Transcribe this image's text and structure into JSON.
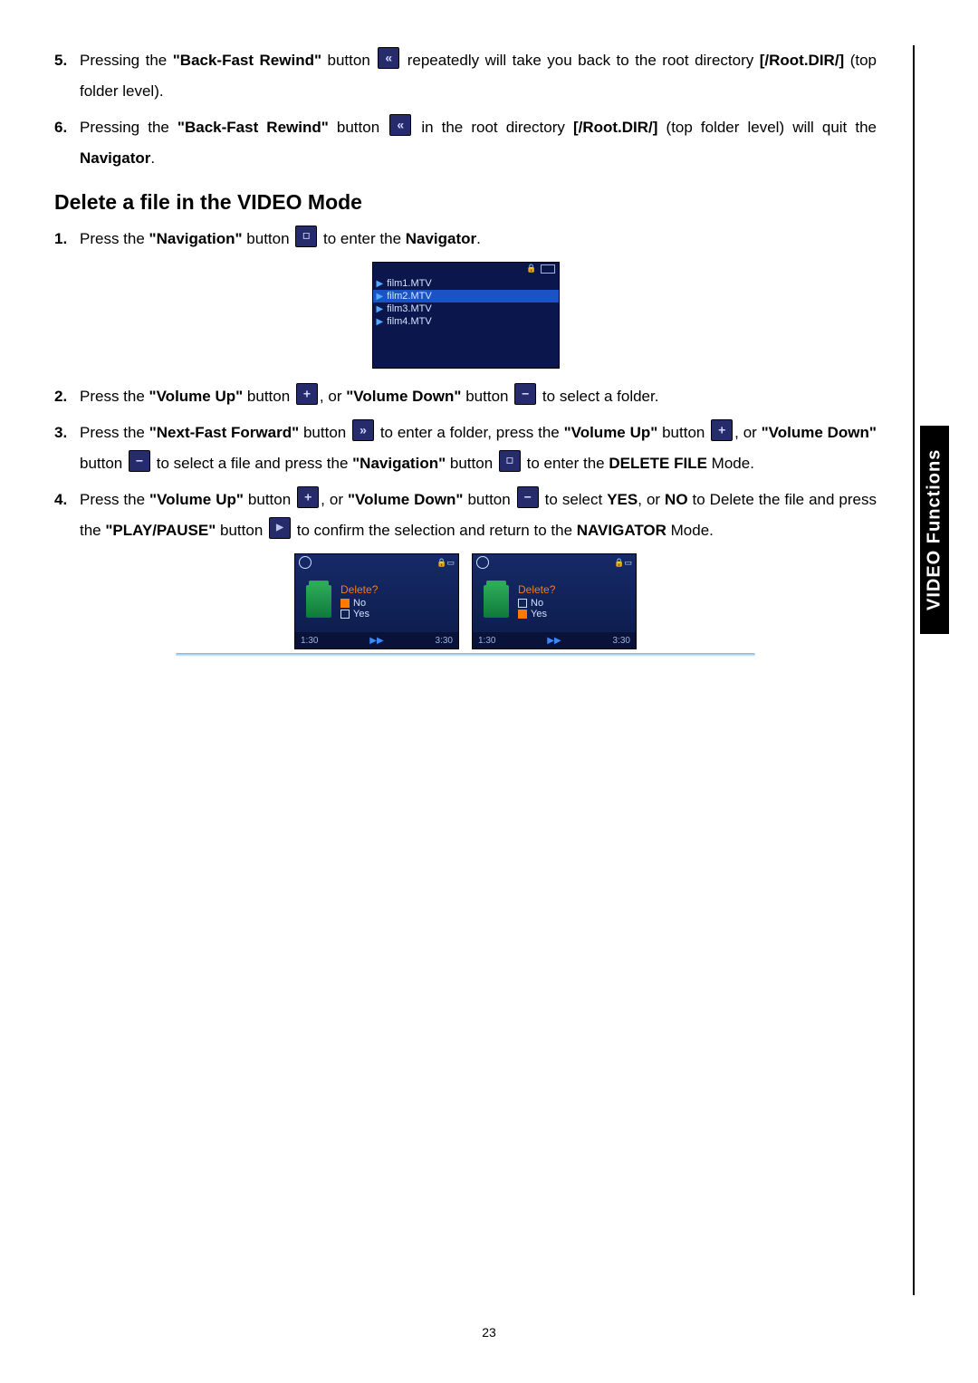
{
  "sidetab": "VIDEO Functions",
  "page_number": "23",
  "top_list": [
    {
      "num": "5.",
      "parts": [
        {
          "t": "Pressing the "
        },
        {
          "t": "\"Back-Fast Rewind\"",
          "b": true
        },
        {
          "t": " button "
        },
        {
          "icon": "rewind"
        },
        {
          "t": " repeatedly will take you back to the root directory "
        },
        {
          "t": "[/Root.DIR/]",
          "b": true
        },
        {
          "t": " (top folder level)."
        }
      ]
    },
    {
      "num": "6.",
      "parts": [
        {
          "t": "Pressing the "
        },
        {
          "t": "\"Back-Fast Rewind\"",
          "b": true
        },
        {
          "t": " button "
        },
        {
          "icon": "rewind"
        },
        {
          "t": " in the root directory "
        },
        {
          "t": "[/Root.DIR/]",
          "b": true
        },
        {
          "t": " (top folder level) will quit the "
        },
        {
          "t": "Navigator",
          "b": true
        },
        {
          "t": "."
        }
      ]
    }
  ],
  "section_title": "Delete a file in the VIDEO Mode",
  "delete_list": [
    {
      "num": "1.",
      "parts": [
        {
          "t": "Press the "
        },
        {
          "t": "\"Navigation\"",
          "b": true
        },
        {
          "t": " button "
        },
        {
          "icon": "nav"
        },
        {
          "t": " to enter the "
        },
        {
          "t": "Navigator",
          "b": true
        },
        {
          "t": "."
        }
      ],
      "navigator_after": true
    },
    {
      "num": "2.",
      "parts": [
        {
          "t": "Press the "
        },
        {
          "t": "\"Volume Up\"",
          "b": true
        },
        {
          "t": " button "
        },
        {
          "icon": "volup"
        },
        {
          "t": ", or "
        },
        {
          "t": "\"Volume Down\"",
          "b": true
        },
        {
          "t": " button "
        },
        {
          "icon": "voldown"
        },
        {
          "t": " to select a folder."
        }
      ]
    },
    {
      "num": "3.",
      "parts": [
        {
          "t": "Press the "
        },
        {
          "t": "\"Next-Fast Forward\"",
          "b": true
        },
        {
          "t": " button "
        },
        {
          "icon": "forward"
        },
        {
          "t": " to enter a folder, press the "
        },
        {
          "t": "\"Volume Up\"",
          "b": true
        },
        {
          "t": " button "
        },
        {
          "icon": "volup"
        },
        {
          "t": ", or "
        },
        {
          "t": "\"Volume Down\"",
          "b": true
        },
        {
          "t": " button "
        },
        {
          "icon": "voldown"
        },
        {
          "t": " to select a file and press the "
        },
        {
          "t": "\"Navigation\"",
          "b": true
        },
        {
          "t": " button "
        },
        {
          "icon": "nav"
        },
        {
          "t": " to enter the "
        },
        {
          "t": "DELETE FILE",
          "b": true
        },
        {
          "t": " Mode."
        }
      ]
    },
    {
      "num": "4.",
      "parts": [
        {
          "t": "Press the "
        },
        {
          "t": "\"Volume Up\"",
          "b": true
        },
        {
          "t": " button "
        },
        {
          "icon": "volup"
        },
        {
          "t": ", or "
        },
        {
          "t": "\"Volume Down\"",
          "b": true
        },
        {
          "t": " button "
        },
        {
          "icon": "voldown"
        },
        {
          "t": " to select "
        },
        {
          "t": "YES",
          "b": true
        },
        {
          "t": ", or "
        },
        {
          "t": "NO",
          "b": true
        },
        {
          "t": " to Delete the file and press the "
        },
        {
          "t": "\"PLAY/PAUSE\"",
          "b": true
        },
        {
          "t": " button "
        },
        {
          "icon": "play"
        },
        {
          "t": " to confirm the selection and return to the "
        },
        {
          "t": "NAVIGATOR",
          "b": true
        },
        {
          "t": " Mode."
        }
      ],
      "dialogs_after": true
    }
  ],
  "navigator_files": [
    {
      "name": "film1.MTV",
      "selected": false
    },
    {
      "name": "film2.MTV",
      "selected": true
    },
    {
      "name": "film3.MTV",
      "selected": false
    },
    {
      "name": "film4.MTV",
      "selected": false
    }
  ],
  "dialog": {
    "prompt": "Delete?",
    "no": "No",
    "yes": "Yes",
    "time_l": "1:30",
    "time_r": "3:30",
    "variants": [
      {
        "selected": "no"
      },
      {
        "selected": "yes"
      }
    ]
  }
}
